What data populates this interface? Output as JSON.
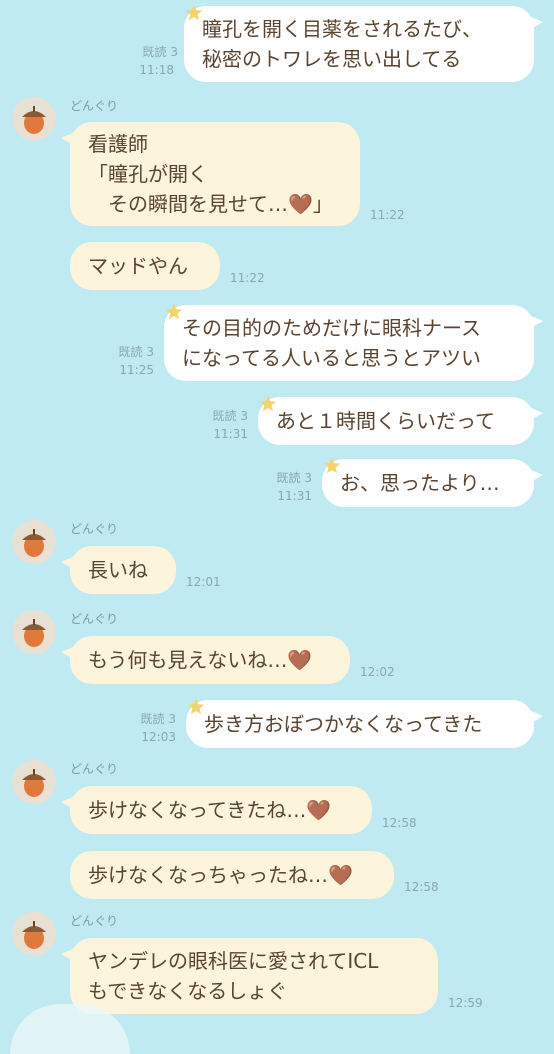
{
  "sender_name": "どんぐり",
  "read_label": "既読 3",
  "colors": {
    "background": "#bfeaf1",
    "bubble_out": "#ffffff",
    "bubble_in": "#fdf4dc",
    "text": "#5a4430",
    "meta": "#8aa7ad",
    "star": "#f4d36a"
  },
  "messages": [
    {
      "dir": "out",
      "text": "瞳孔を開く目薬をされるたび、\n秘密のトワレを思い出してる",
      "read": "既読 3",
      "time": "11:18"
    },
    {
      "dir": "in",
      "text": "看護師\n「瞳孔が開く\n　その瞬間を見せて…🤎」",
      "time": "11:22"
    },
    {
      "dir": "in",
      "text": "マッドやん",
      "time": "11:22"
    },
    {
      "dir": "out",
      "text": "その目的のためだけに眼科ナース\nになってる人いると思うとアツい",
      "read": "既読 3",
      "time": "11:25"
    },
    {
      "dir": "out",
      "text": "あと１時間くらいだって",
      "read": "既読 3",
      "time": "11:31"
    },
    {
      "dir": "out",
      "text": "お、思ったより…",
      "read": "既読 3",
      "time": "11:31"
    },
    {
      "dir": "in",
      "text": "長いね",
      "time": "12:01"
    },
    {
      "dir": "in",
      "text": "もう何も見えないね…🤎",
      "time": "12:02"
    },
    {
      "dir": "out",
      "text": "歩き方おぼつかなくなってきた",
      "read": "既読 3",
      "time": "12:03"
    },
    {
      "dir": "in",
      "text": "歩けなくなってきたね…🤎",
      "time": "12:58"
    },
    {
      "dir": "in",
      "text": "歩けなくなっちゃったね…🤎",
      "time": "12:58"
    },
    {
      "dir": "in",
      "text": "ヤンデレの眼科医に愛されてICL\nもできなくなるしょぐ",
      "time": "12:59"
    }
  ]
}
